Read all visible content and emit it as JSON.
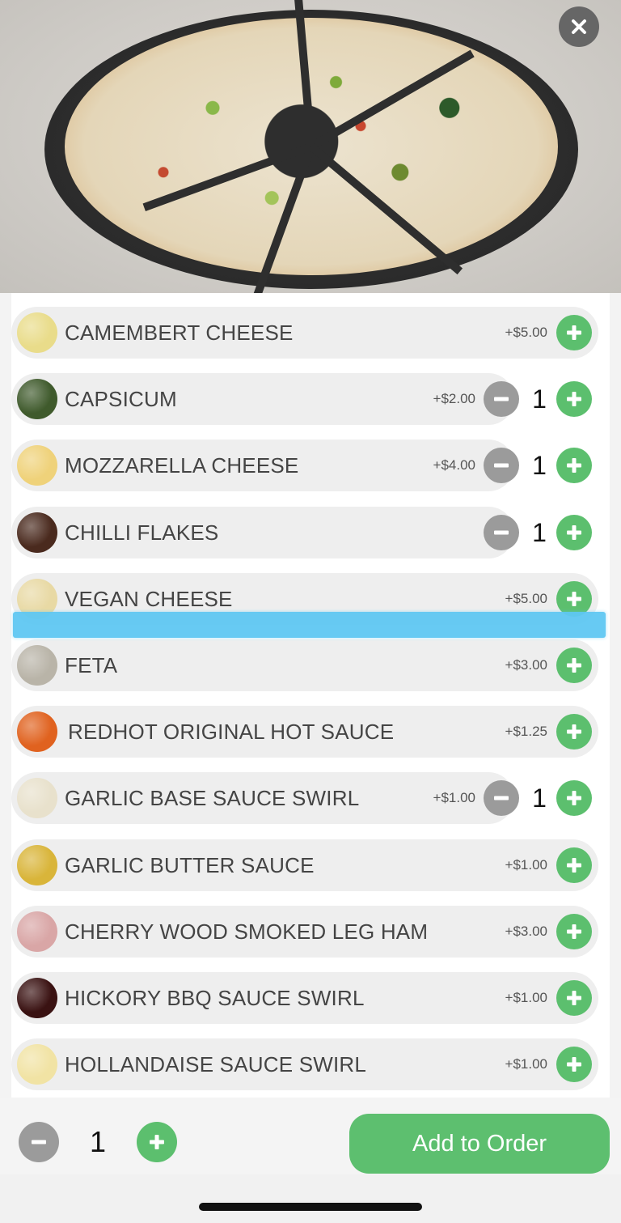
{
  "hero": {
    "image_alt": "Vegetarian pizza on slate board",
    "close_icon": "close-icon"
  },
  "colors": {
    "accent_green": "#5cbf6e",
    "minus_gray": "#9b9b9b",
    "pill_bg": "#eeeeee",
    "drag_highlight": "#5fc8f3"
  },
  "extras": [
    {
      "name": "CAMEMBERT CHEESE",
      "price": "+$5.00",
      "qty": null,
      "thumb_color": "#e9dc8a"
    },
    {
      "name": "CAPSICUM",
      "price": "+$2.00",
      "qty": "1",
      "thumb_color": "#3f5a2c"
    },
    {
      "name": "MOZZARELLA CHEESE",
      "price": "+$4.00",
      "qty": "1",
      "thumb_color": "#efd27a"
    },
    {
      "name": "CHILLI FLAKES",
      "price": "",
      "qty": "1",
      "thumb_color": "#4a2a1e"
    },
    {
      "name": "VEGAN CHEESE",
      "price": "+$5.00",
      "qty": null,
      "thumb_color": "#e8d9a4"
    },
    {
      "name": "FETA",
      "price": "+$3.00",
      "qty": null,
      "thumb_color": "#b9b4a8"
    },
    {
      "name": "REDHOT ORIGINAL HOT SAUCE",
      "price": "+$1.25",
      "qty": null,
      "thumb_color": "#e0621f"
    },
    {
      "name": "GARLIC BASE SAUCE SWIRL",
      "price": "+$1.00",
      "qty": "1",
      "thumb_color": "#e8e1cc"
    },
    {
      "name": "GARLIC BUTTER SAUCE",
      "price": "+$1.00",
      "qty": null,
      "thumb_color": "#d9b53a"
    },
    {
      "name": "CHERRY WOOD SMOKED LEG HAM",
      "price": "+$3.00",
      "qty": null,
      "thumb_color": "#d9a6a6"
    },
    {
      "name": "HICKORY BBQ SAUCE SWIRL",
      "price": "+$1.00",
      "qty": null,
      "thumb_color": "#3a1212"
    },
    {
      "name": "HOLLANDAISE SAUCE SWIRL",
      "price": "+$1.00",
      "qty": null,
      "thumb_color": "#f1e3a4"
    }
  ],
  "footer": {
    "quantity": "1",
    "add_label": "Add to Order"
  }
}
